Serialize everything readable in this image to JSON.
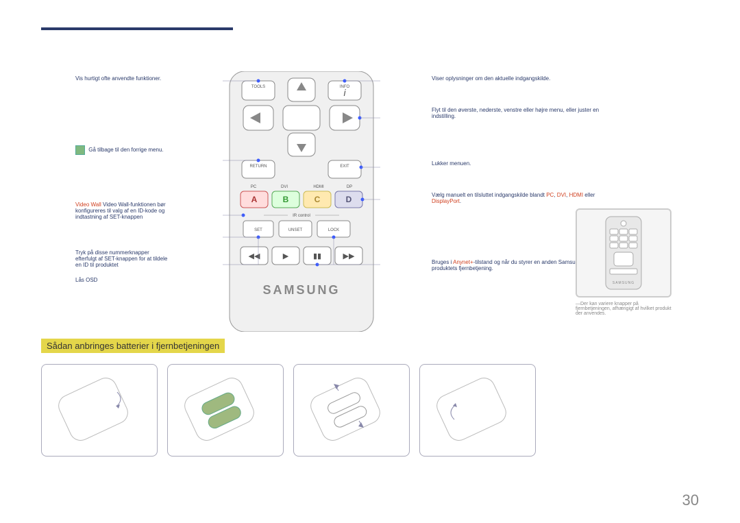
{
  "page_number": "30",
  "section_heading": "Sådan anbringes batterier i fjernbetjeningen",
  "remote_brand": "SAMSUNG",
  "remote_buttons": {
    "tools": "TOOLS",
    "info": "INFO",
    "return": "RETURN",
    "exit": "EXIT",
    "set": "SET",
    "unset": "UNSET",
    "lock": "LOCK",
    "a": "A",
    "b": "B",
    "c": "C",
    "d": "D",
    "pc": "PC",
    "dvi": "DVI",
    "hdmi": "HDMI",
    "dp": "DP",
    "id_control": "IR control"
  },
  "left_annotations": {
    "tools_label": "Vis hurtigt ofte anvendte funktioner.",
    "return_label": "Gå tilbage til den forrige menu.",
    "return_icon": "green-indicator",
    "id_control_label": "Video Wall-funktionen bør konfigureres til valg af en ID-kode og indtastning af SET-knappen",
    "set_label": "Tryk på disse nummerknapper efterfulgt af SET-knappen for at tildele en ID til produktet",
    "lock_label": "Lås OSD"
  },
  "right_annotations": {
    "info_label": "Viser oplysninger om den aktuelle indgangskilde.",
    "nav_label": "Flyt til den øverste, nederste, venstre eller højre menu, eller juster en indstilling.",
    "exit_label": "Lukker menuen.",
    "source_label": "Vælg manuelt en tilsluttet indgangskilde blandt ",
    "source_red1": "PC",
    "source_red2": "DVI",
    "source_red3": "HDMI",
    "source_or": " eller ",
    "source_red4": "DisplayPort",
    "source_end": ".",
    "anynet_prefix": "Bruges i ",
    "anynet_red": "Anynet+",
    "anynet_suffix": "-tilstand og når du styrer en anden Samsung-enhed med produktets fjernbetjening."
  },
  "side_note": "―Der kan variere knapper på fjernbetjeningen, afhængigt af hvilket produkt der anvendes."
}
